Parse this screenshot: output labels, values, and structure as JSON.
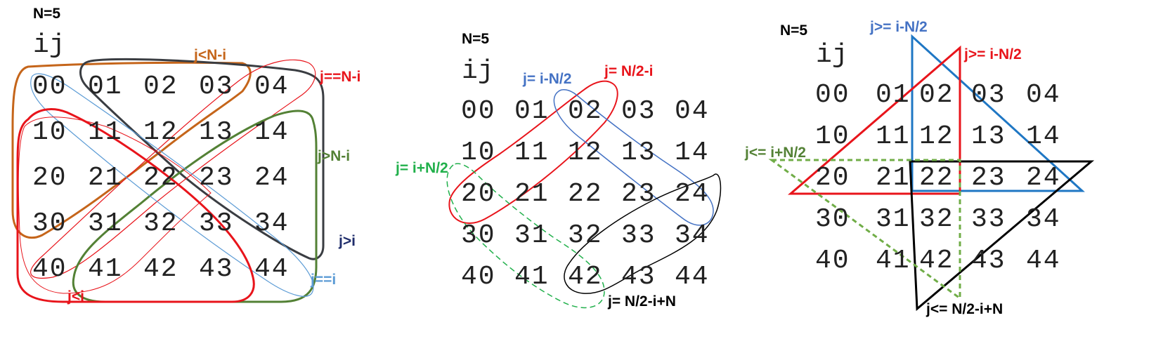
{
  "panels": [
    {
      "n_label": "N=5",
      "header": "ij",
      "rows": [
        [
          "00",
          "01",
          "02",
          "03",
          "04"
        ],
        [
          "10",
          "11",
          "12",
          "13",
          "14"
        ],
        [
          "20",
          "21",
          "22",
          "23",
          "24"
        ],
        [
          "30",
          "31",
          "32",
          "33",
          "34"
        ],
        [
          "40",
          "41",
          "42",
          "43",
          "44"
        ]
      ],
      "labels": {
        "j_lt_n_minus_i": "j<N-i",
        "j_eq_n_minus_i": "j==N-i",
        "j_gt_n_minus_i": "j>N-i",
        "j_gt_i": "j>i",
        "j_eq_i": "j==i",
        "j_lt_i": "j<i"
      }
    },
    {
      "n_label": "N=5",
      "header": "ij",
      "rows": [
        [
          "00",
          "01",
          "02",
          "03",
          "04"
        ],
        [
          "10",
          "11",
          "12",
          "13",
          "14"
        ],
        [
          "20",
          "21",
          "22",
          "23",
          "24"
        ],
        [
          "30",
          "31",
          "32",
          "33",
          "34"
        ],
        [
          "40",
          "41",
          "42",
          "43",
          "44"
        ]
      ],
      "labels": {
        "j_eq_i_minus_half": "j= i-N/2",
        "j_eq_half_minus_i": "j= N/2-i",
        "j_eq_i_plus_half": "j= i+N/2",
        "j_eq_half_minus_i_plus_n": "j= N/2-i+N"
      }
    },
    {
      "n_label": "N=5",
      "header": "ij",
      "rows": [
        [
          "00",
          "01",
          "02",
          "03",
          "04"
        ],
        [
          "10",
          "11",
          "12",
          "13",
          "14"
        ],
        [
          "20",
          "21",
          "22",
          "23",
          "24"
        ],
        [
          "30",
          "31",
          "32",
          "33",
          "34"
        ],
        [
          "40",
          "41",
          "42",
          "43",
          "44"
        ]
      ],
      "labels": {
        "blue_ge": "j>= i-N/2",
        "red_ge": "j>= i-N/2",
        "green_le": "j<= i+N/2",
        "black_le": "j<= N/2-i+N"
      }
    }
  ],
  "colors": {
    "orange": "#C5651A",
    "dark_gray": "#3A3D42",
    "red": "#E8141B",
    "green": "#538135",
    "navy": "#1F2D6B",
    "light_blue": "#5B9BD5",
    "blue": "#4472C4",
    "bright_green": "#21B04B",
    "black": "#000000",
    "tri_blue": "#1F77C4",
    "dash_green": "#70AD47"
  }
}
